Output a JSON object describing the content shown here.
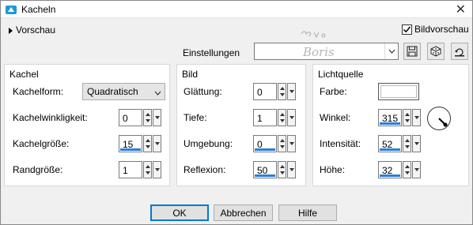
{
  "window": {
    "title": "Kacheln",
    "close_glyph": "✕"
  },
  "preview": {
    "label": "Vorschau"
  },
  "bildvorschau": {
    "label": "Bildvorschau",
    "checked": true
  },
  "settings": {
    "label": "Einstellungen",
    "value": ""
  },
  "watermark": {
    "text": "Boris"
  },
  "kachel": {
    "title": "Kachel",
    "kachelform_label": "Kachelform:",
    "kachelform_value": "Quadratisch",
    "winkligkeit_label": "Kachelwinkligkeit:",
    "winkligkeit_value": "0",
    "groesse_label": "Kachelgröße:",
    "groesse_value": "15",
    "rand_label": "Randgröße:",
    "rand_value": "1"
  },
  "bild": {
    "title": "Bild",
    "glaettung_label": "Glättung:",
    "glaettung_value": "0",
    "tiefe_label": "Tiefe:",
    "tiefe_value": "1",
    "umgebung_label": "Umgebung:",
    "umgebung_value": "0",
    "reflexion_label": "Reflexion:",
    "reflexion_value": "50"
  },
  "licht": {
    "title": "Lichtquelle",
    "farbe_label": "Farbe:",
    "farbe_color": "#ffffff",
    "winkel_label": "Winkel:",
    "winkel_value": "315",
    "intensitaet_label": "Intensität:",
    "intensitaet_value": "52",
    "hoehe_label": "Höhe:",
    "hoehe_value": "32"
  },
  "buttons": {
    "ok": "OK",
    "cancel": "Abbrechen",
    "help": "Hilfe"
  },
  "colors": {
    "accent": "#2a7ed6",
    "title_icon": "#1e9ad6"
  }
}
